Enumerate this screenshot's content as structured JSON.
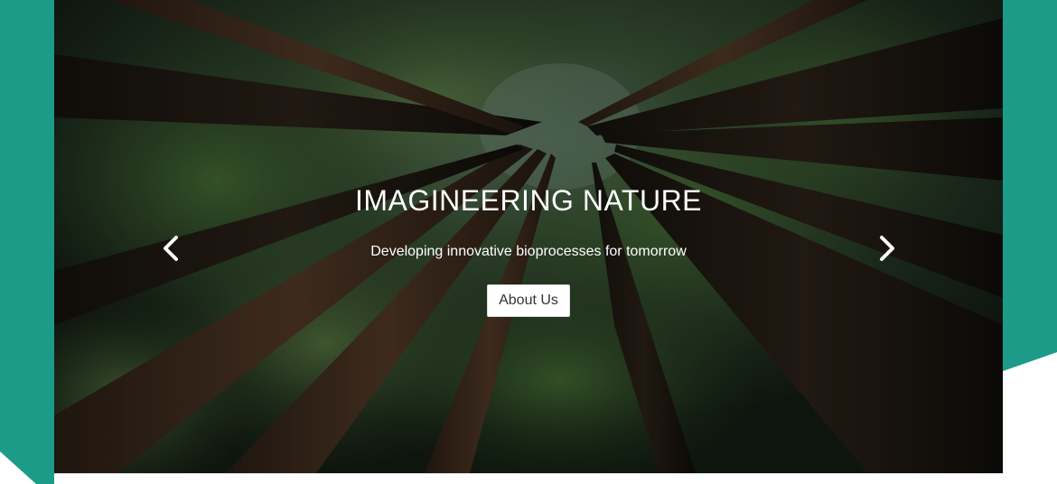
{
  "slider": {
    "title": "IMAGINEERING NATURE",
    "subtitle": "Developing innovative bioprocesses for tomorrow",
    "button_label": "About Us",
    "prev_icon": "chevron-left-icon",
    "next_icon": "chevron-right-icon"
  },
  "theme": {
    "accent": "#1b9b88",
    "overlay": "#0a0e0a",
    "button_bg": "#ffffff",
    "text": "#ffffff"
  }
}
